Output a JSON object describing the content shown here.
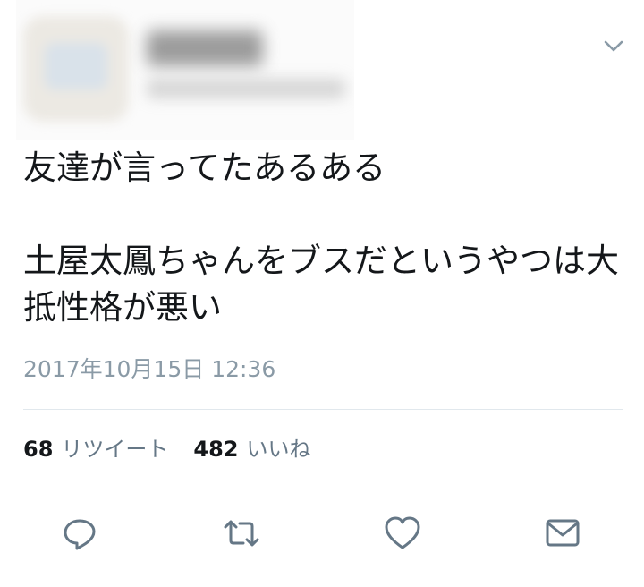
{
  "tweet": {
    "text": "友達が言ってたあるある\n\n土屋太鳳ちゃんをブスだというやつは大抵性格が悪い",
    "timestamp": "2017年10月15日 12:36"
  },
  "stats": {
    "retweets": {
      "count": "68",
      "label": "リツイート"
    },
    "likes": {
      "count": "482",
      "label": "いいね"
    }
  },
  "icons": {
    "menu": "chevron-down-icon",
    "reply": "reply-icon",
    "retweet": "retweet-icon",
    "like": "heart-icon",
    "share": "envelope-icon"
  },
  "colors": {
    "text": "#14171a",
    "muted": "#657786",
    "timestamp": "#8a9aa6",
    "icon": "#657786",
    "divider": "#e1e8ed"
  }
}
